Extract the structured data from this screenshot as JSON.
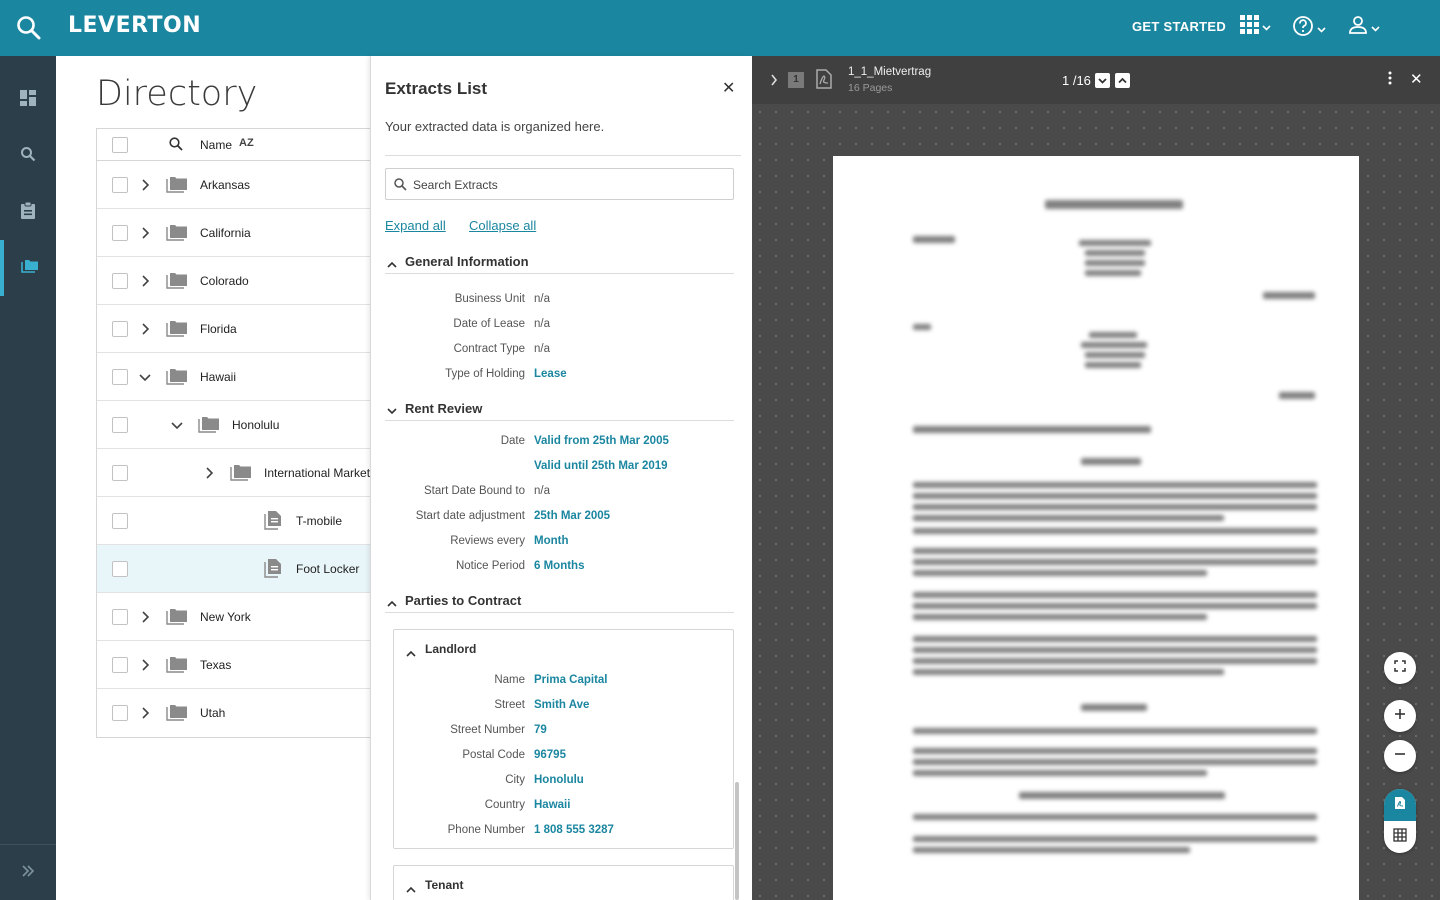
{
  "topbar": {
    "logo": "LEVERTON",
    "get_started": "GET STARTED"
  },
  "directory": {
    "title": "Directory",
    "header": {
      "name": "Name",
      "sort": "AZ"
    },
    "rows": [
      {
        "label": "Arkansas",
        "type": "folder",
        "expanded": false
      },
      {
        "label": "California",
        "type": "folder",
        "expanded": false
      },
      {
        "label": "Colorado",
        "type": "folder",
        "expanded": false
      },
      {
        "label": "Florida",
        "type": "folder",
        "expanded": false
      },
      {
        "label": "Hawaii",
        "type": "folder",
        "expanded": true
      },
      {
        "label": "Honolulu",
        "type": "folder",
        "expanded": true
      },
      {
        "label": "International Market",
        "type": "folder",
        "expanded": false
      },
      {
        "label": "T-mobile",
        "type": "file"
      },
      {
        "label": "Foot Locker",
        "type": "file",
        "selected": true
      },
      {
        "label": "New York",
        "type": "folder",
        "expanded": false
      },
      {
        "label": "Texas",
        "type": "folder",
        "expanded": false
      },
      {
        "label": "Utah",
        "type": "folder",
        "expanded": false
      }
    ]
  },
  "extracts": {
    "title": "Extracts List",
    "subtitle": "Your extracted data is organized here.",
    "search_placeholder": "Search Extracts",
    "expand_all": "Expand all",
    "collapse_all": "Collapse all",
    "general": {
      "title": "General Information",
      "fields": [
        {
          "label": "Business Unit",
          "value": "n/a"
        },
        {
          "label": "Date of Lease",
          "value": "n/a"
        },
        {
          "label": "Contract Type",
          "value": "n/a"
        },
        {
          "label": "Type of Holding",
          "value": "Lease"
        }
      ]
    },
    "rent_review": {
      "title": "Rent Review",
      "fields": [
        {
          "label": "Date",
          "value": "Valid from 25th Mar 2005"
        },
        {
          "label": "",
          "value": "Valid until 25th Mar 2019"
        },
        {
          "label": "Start Date Bound to",
          "value": "n/a"
        },
        {
          "label": "Start  date adjustment",
          "value": "25th Mar 2005"
        },
        {
          "label": "Reviews every",
          "value": "Month"
        },
        {
          "label": "Notice Period",
          "value": "6 Months"
        }
      ]
    },
    "parties": {
      "title": "Parties to Contract",
      "landlord": {
        "title": "Landlord",
        "fields": [
          {
            "label": "Name",
            "value": "Prima Capital"
          },
          {
            "label": "Street",
            "value": "Smith Ave"
          },
          {
            "label": "Street Number",
            "value": "79"
          },
          {
            "label": "Postal Code",
            "value": "96795"
          },
          {
            "label": "City",
            "value": "Honolulu"
          },
          {
            "label": "Country",
            "value": "Hawaii"
          },
          {
            "label": "Phone Number",
            "value": "1 808 555 3287"
          }
        ]
      },
      "tenant": {
        "title": "Tenant"
      }
    }
  },
  "viewer": {
    "page_badge": "1",
    "file_name": "1_1_Mietvertrag",
    "file_pages": "16 Pages",
    "pager": "1 /16"
  },
  "colors": {
    "brand": "#1b86a0",
    "rail": "#2c3e4a",
    "selected_row": "#e8f5f9"
  }
}
